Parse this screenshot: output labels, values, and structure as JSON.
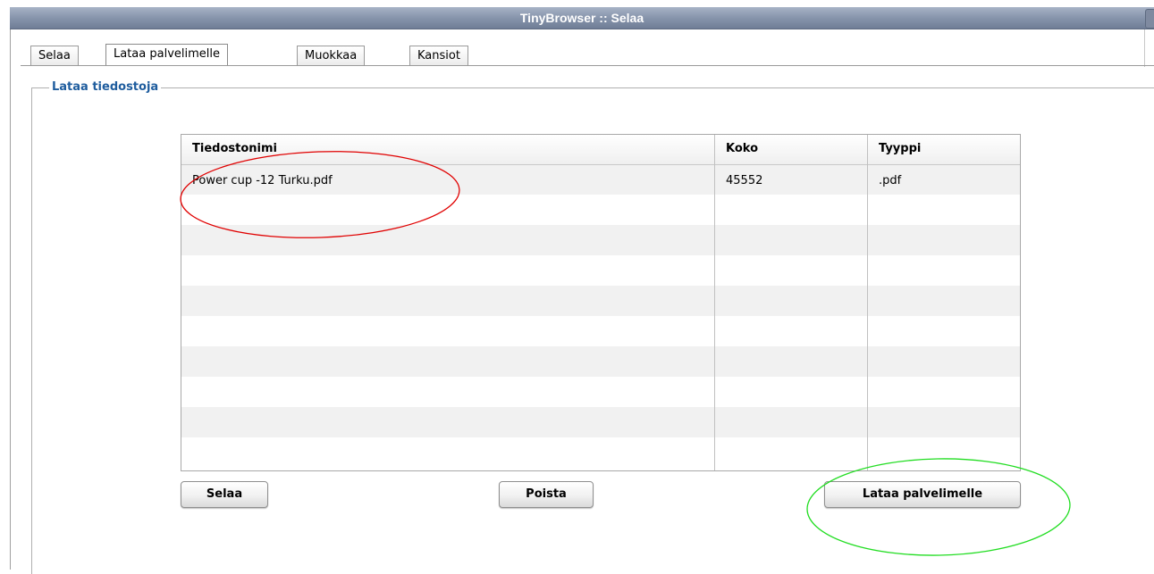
{
  "window": {
    "title": "TinyBrowser :: Selaa"
  },
  "tabs": [
    {
      "label": "Selaa",
      "active": false
    },
    {
      "label": "Lataa palvelimelle",
      "active": true
    },
    {
      "label": "Muokkaa",
      "active": false
    },
    {
      "label": "Kansiot",
      "active": false
    }
  ],
  "upload_panel": {
    "legend": "Lataa tiedostoja",
    "columns": [
      "Tiedostonimi",
      "Koko",
      "Tyyppi"
    ],
    "rows": [
      {
        "name": "Power cup -12 Turku.pdf",
        "size": "45552",
        "type": ".pdf"
      }
    ]
  },
  "buttons": {
    "browse": "Selaa",
    "remove": "Poista",
    "upload": "Lataa palvelimelle"
  },
  "annotation_colors": {
    "red_ellipse": "#e00000",
    "green_ellipse": "#22dd22"
  },
  "colors": {
    "legend_text": "#1f5d9e",
    "titlebar": "#8a97ae"
  }
}
